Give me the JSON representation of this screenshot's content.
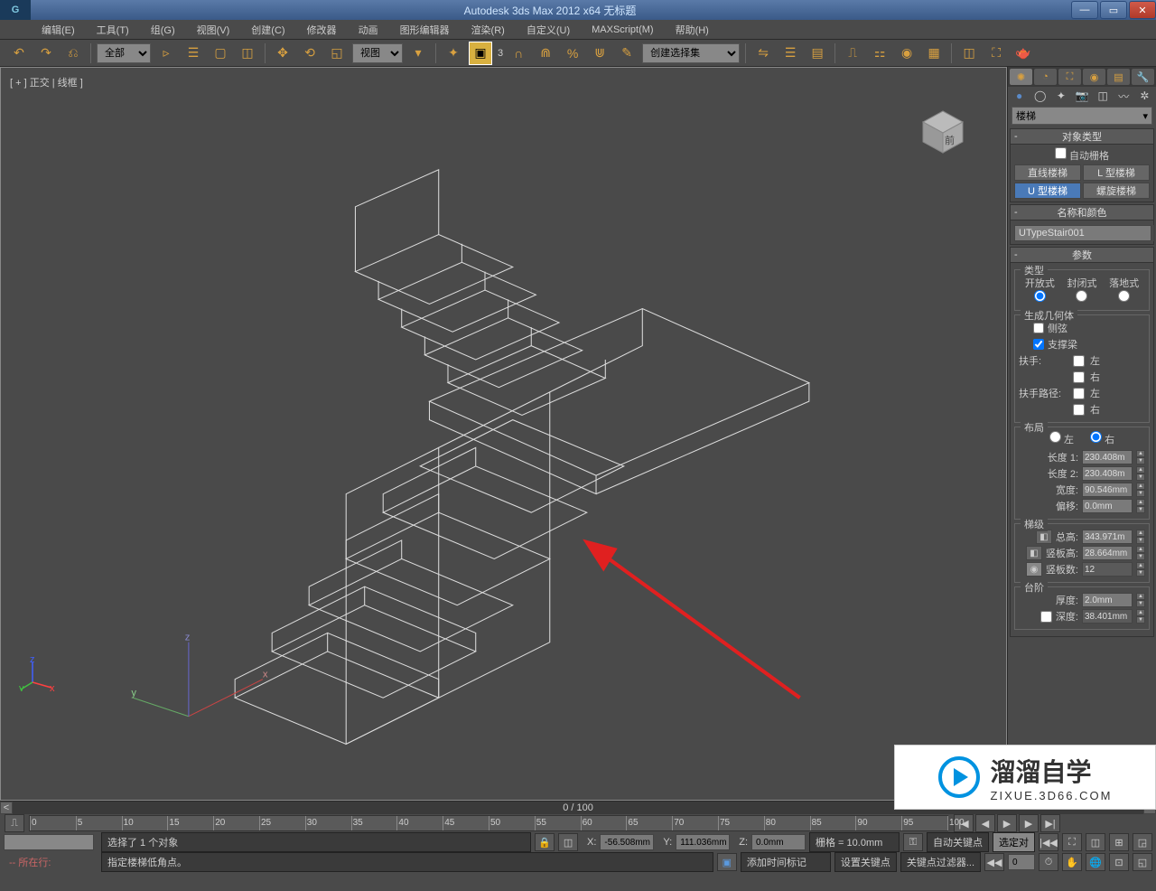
{
  "title": "Autodesk 3ds Max  2012 x64    无标题",
  "menu": [
    "编辑(E)",
    "工具(T)",
    "组(G)",
    "视图(V)",
    "创建(C)",
    "修改器",
    "动画",
    "图形编辑器",
    "渲染(R)",
    "自定义(U)",
    "MAXScript(M)",
    "帮助(H)"
  ],
  "toolbar": {
    "filter_all": "全部",
    "view_label": "视图",
    "create_set": "创建选择集",
    "snap_num": "3"
  },
  "viewport": {
    "label": "[ + ] 正交 | 线框 ]"
  },
  "rightpanel": {
    "category": "楼梯",
    "obj_type_header": "对象类型",
    "auto_grid": "自动栅格",
    "types": [
      "直线楼梯",
      "L 型楼梯",
      "U 型楼梯",
      "螺旋楼梯"
    ],
    "active_type_idx": 2,
    "name_color_header": "名称和颜色",
    "object_name": "UTypeStair001",
    "params_header": "参数",
    "type_group": "类型",
    "type_options": [
      "开放式",
      "封闭式",
      "落地式"
    ],
    "gen_geom": "生成几何体",
    "stringers": "侧弦",
    "carriage": "支撑梁",
    "handrail": "扶手:",
    "rail_path": "扶手路径:",
    "left": "左",
    "right": "右",
    "layout_group": "布局",
    "layout_left": "左",
    "layout_right": "右",
    "length1_lbl": "长度 1:",
    "length1": "230.408m",
    "length2_lbl": "长度 2:",
    "length2": "230.408m",
    "width_lbl": "宽度:",
    "width": "90.546mm",
    "offset_lbl": "偏移:",
    "offset": "0.0mm",
    "rise_group": "梯级",
    "overall_lbl": "总高:",
    "overall": "343.971m",
    "riser_ht_lbl": "竖板高:",
    "riser_ht": "28.664mm",
    "riser_ct_lbl": "竖板数:",
    "riser_ct": "12",
    "steps_group": "台阶",
    "thickness_lbl": "厚度:",
    "thickness": "2.0mm",
    "depth_lbl": "深度:",
    "depth": "38.401mm"
  },
  "timeline": {
    "frame_counter": "0 / 100",
    "ticks": [
      "0",
      "5",
      "10",
      "15",
      "20",
      "25",
      "30",
      "35",
      "40",
      "45",
      "50",
      "55",
      "60",
      "65",
      "70",
      "75",
      "80",
      "85",
      "90",
      "95",
      "100"
    ]
  },
  "status": {
    "selection": "选择了 1 个对象",
    "prompt": "指定楼梯低角点。",
    "x": "-56.508mm",
    "y": "111.036mm",
    "z": "0.0mm",
    "grid": "栅格 = 10.0mm",
    "autokey": "自动关键点",
    "selected": "选定对",
    "setkey": "设置关键点",
    "keyfilter": "关键点过滤器...",
    "addtime": "添加时间标记",
    "now_at": "所在行:",
    "frame_num": "0"
  },
  "watermark": {
    "main": "溜溜自学",
    "sub": "ZIXUE.3D66.COM"
  }
}
